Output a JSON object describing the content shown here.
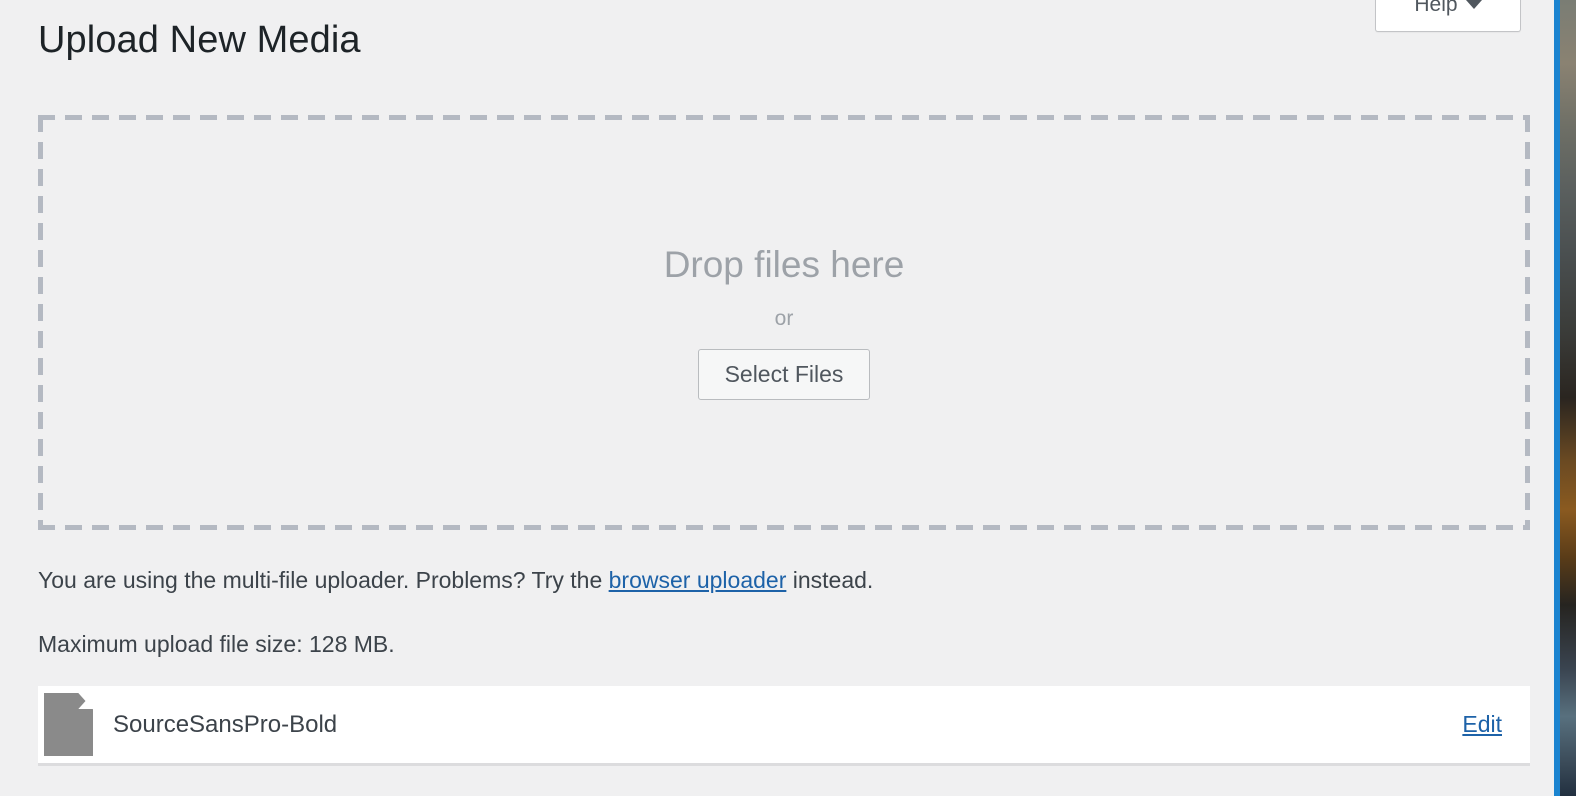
{
  "header": {
    "page_title": "Upload New Media",
    "help_button_label": "Help",
    "help_caret_icon": "chevron-down-icon"
  },
  "drop_zone": {
    "headline": "Drop files here",
    "or_label": "or",
    "select_files_label": "Select Files"
  },
  "notes": {
    "uploader_note_prefix": "You are using the multi-file uploader. Problems? Try the ",
    "uploader_note_link": "browser uploader",
    "uploader_note_suffix": " instead.",
    "max_upload_size": "Maximum upload file size: 128 MB."
  },
  "media_list": {
    "items": [
      {
        "file_icon": "document-file-icon",
        "name": "SourceSansPro-Bold",
        "edit_label": "Edit"
      }
    ]
  },
  "colors": {
    "page_background": "#f0f0f1",
    "title_text": "#1d2327",
    "body_text": "#3c434a",
    "muted_text": "#9da2a8",
    "link": "#1d62a8",
    "dash_border": "#b4b9c2",
    "row_background": "#ffffff",
    "browser_edge": "#1b84d0"
  }
}
